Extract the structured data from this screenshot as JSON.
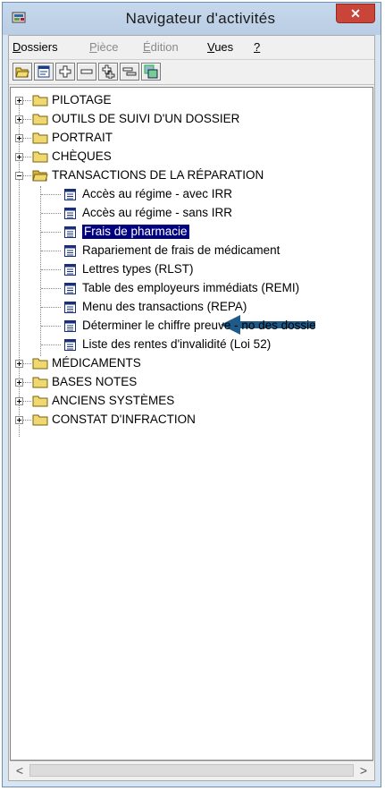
{
  "window": {
    "title": "Navigateur d'activités",
    "close_label": "✕"
  },
  "menubar": {
    "items": [
      {
        "label": "Dossiers",
        "accel": "D",
        "rest": "ossiers",
        "enabled": true
      },
      {
        "label": "Pièce",
        "accel": "P",
        "rest": "ièce",
        "enabled": false
      },
      {
        "label": "Édition",
        "accel": "É",
        "rest": "dition",
        "enabled": false
      },
      {
        "label": "Vues",
        "accel": "V",
        "rest": "ues",
        "enabled": true
      },
      {
        "label": "?",
        "accel": "?",
        "rest": "",
        "enabled": true
      }
    ]
  },
  "toolbar": {
    "buttons": [
      "open-folder-icon",
      "properties-icon",
      "expand-icon",
      "collapse-icon",
      "expand-all-icon",
      "collapse-all-icon",
      "copy-windows-icon"
    ]
  },
  "tree": {
    "folders": [
      {
        "label": "PILOTAGE",
        "expanded": false
      },
      {
        "label": "OUTILS DE SUIVI D'UN DOSSIER",
        "expanded": false
      },
      {
        "label": "PORTRAIT",
        "expanded": false
      },
      {
        "label": "CHÈQUES",
        "expanded": false
      },
      {
        "label": "TRANSACTIONS DE LA RÉPARATION",
        "expanded": true
      }
    ],
    "children": [
      {
        "label": "Accès au régime - avec IRR",
        "selected": false
      },
      {
        "label": "Accès au régime - sans IRR",
        "selected": false
      },
      {
        "label": "Frais de pharmacie",
        "selected": true
      },
      {
        "label": "Rapariement de frais de médicament",
        "selected": false
      },
      {
        "label": "Lettres types (RLST)",
        "selected": false
      },
      {
        "label": "Table des employeurs immédiats (REMI)",
        "selected": false
      },
      {
        "label": "Menu des transactions (REPA)",
        "selected": false
      },
      {
        "label": "Déterminer le chiffre preuve - no des dossie",
        "selected": false
      },
      {
        "label": "Liste des rentes d'invalidité (Loi 52)",
        "selected": false
      }
    ],
    "folders_after": [
      {
        "label": "MÉDICAMENTS",
        "expanded": false
      },
      {
        "label": "BASES NOTES",
        "expanded": false
      },
      {
        "label": "ANCIENS SYSTÈMES",
        "expanded": false
      },
      {
        "label": "CONSTAT D'INFRACTION",
        "expanded": false
      }
    ]
  },
  "scrollbar": {
    "left_label": "<",
    "right_label": ">"
  },
  "colors": {
    "selection": "#000080",
    "arrow": "#1f5b8a",
    "folder": "#e8c84a"
  }
}
